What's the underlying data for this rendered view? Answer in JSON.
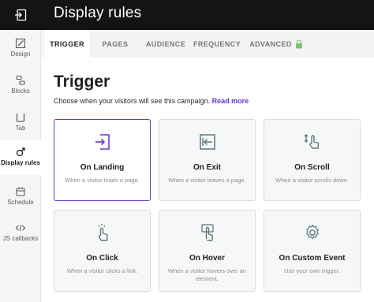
{
  "header": {
    "title": "Display rules",
    "back_icon": "exit-icon"
  },
  "sidebar": {
    "items": [
      {
        "label": "Design",
        "icon": "pencil-ruler-icon"
      },
      {
        "label": "Blocks",
        "icon": "blocks-icon"
      },
      {
        "label": "Tab",
        "icon": "tab-icon"
      },
      {
        "label": "Display rules",
        "icon": "pointer-click-icon",
        "active": true
      },
      {
        "label": "Schedule",
        "icon": "calendar-icon"
      },
      {
        "label": "JS callbacks",
        "icon": "code-icon"
      }
    ]
  },
  "tabs": [
    {
      "label": "TRIGGER",
      "active": true
    },
    {
      "label": "PAGES"
    },
    {
      "label": "AUDIENCE"
    },
    {
      "label": "FREQUENCY"
    },
    {
      "label": "ADVANCED",
      "icon": "lock-icon"
    }
  ],
  "main": {
    "heading": "Trigger",
    "subtext": "Choose when your visitors will see this campaign.",
    "read_more": "Read more"
  },
  "cards": [
    {
      "title": "On Landing",
      "desc": "When a visitor loads a page.",
      "icon": "enter-icon",
      "selected": true
    },
    {
      "title": "On Exit",
      "desc": "When a visitor leaves a page.",
      "icon": "exit-arrow-icon"
    },
    {
      "title": "On Scroll",
      "desc": "When a visitor scrolls down.",
      "icon": "scroll-hand-icon"
    },
    {
      "title": "On Click",
      "desc": "When a visitor clicks a link.",
      "icon": "tap-hand-icon"
    },
    {
      "title": "On Hover",
      "desc": "When a visitor hovers over an element.",
      "icon": "hover-hand-icon"
    },
    {
      "title": "On Custom Event",
      "desc": "Use your own trigger.",
      "icon": "gear-icon"
    }
  ],
  "colors": {
    "accent": "#6b35c9",
    "topbar": "#141414",
    "icon_gray": "#5b7a78"
  }
}
